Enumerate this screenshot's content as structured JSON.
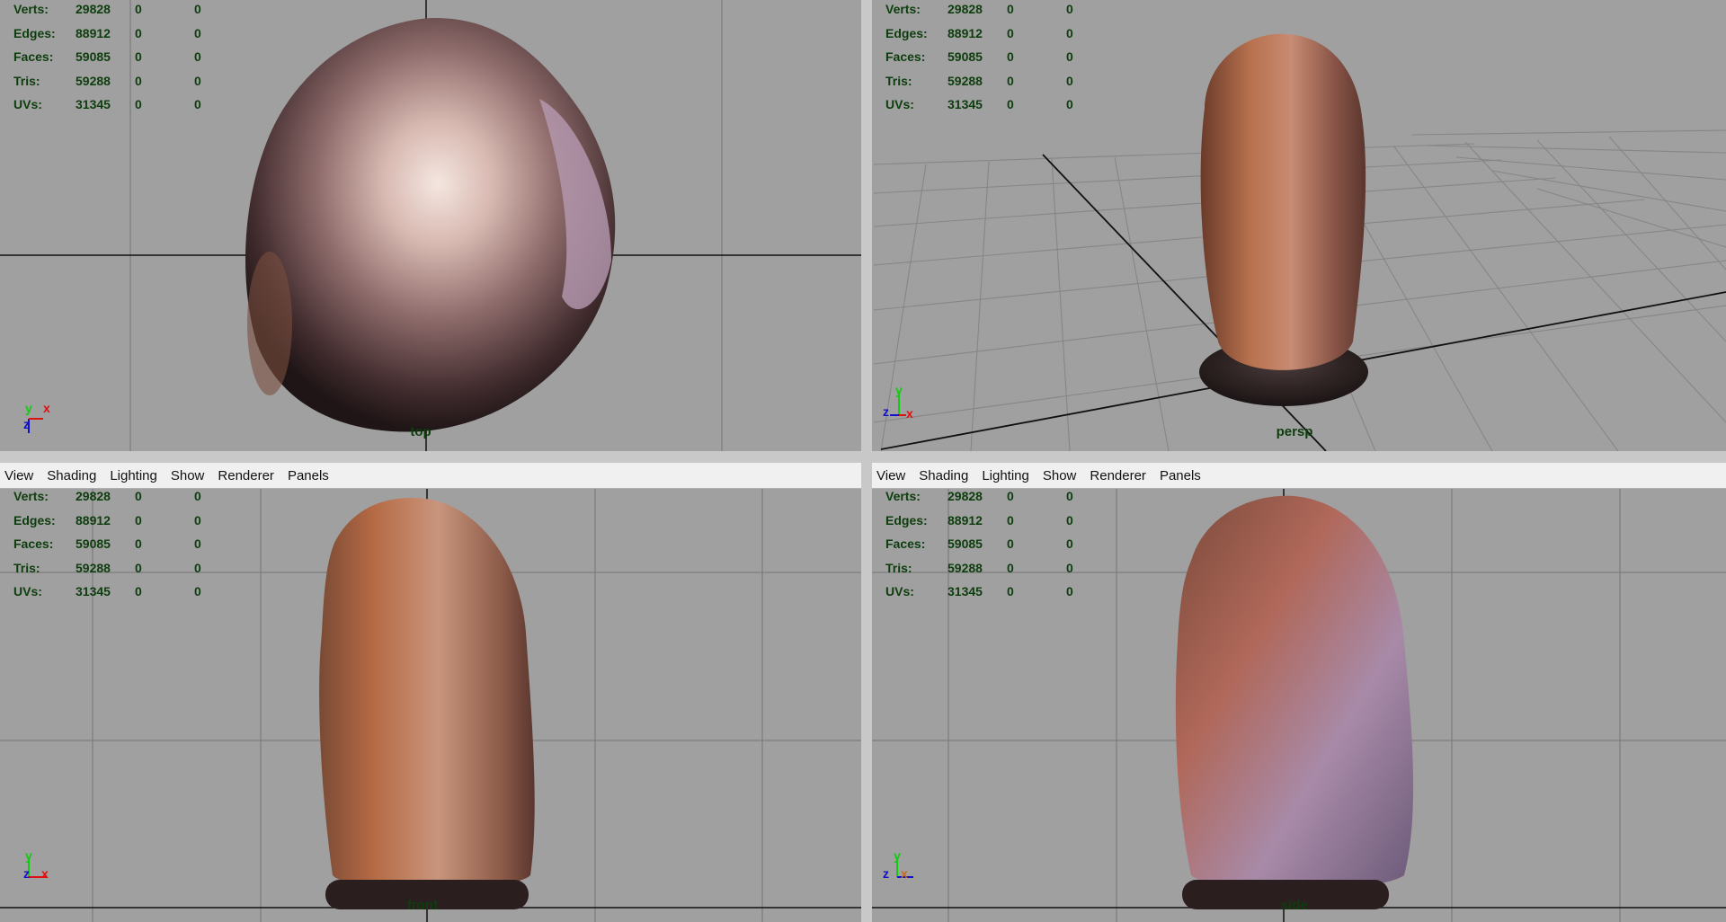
{
  "menu": [
    "View",
    "Shading",
    "Lighting",
    "Show",
    "Renderer",
    "Panels"
  ],
  "hud": {
    "rows": [
      {
        "label": "Verts:",
        "values": [
          "29828",
          "0",
          "0"
        ]
      },
      {
        "label": "Edges:",
        "values": [
          "88912",
          "0",
          "0"
        ]
      },
      {
        "label": "Faces:",
        "values": [
          "59085",
          "0",
          "0"
        ]
      },
      {
        "label": "Tris:",
        "values": [
          "59288",
          "0",
          "0"
        ]
      },
      {
        "label": "UVs:",
        "values": [
          "31345",
          "0",
          "0"
        ]
      }
    ]
  },
  "panels": {
    "top": {
      "camera": "top",
      "axes": [
        "y",
        "x",
        "z"
      ]
    },
    "persp": {
      "camera": "persp",
      "axes": [
        "y",
        "z",
        "x"
      ]
    },
    "front": {
      "camera": "front",
      "axes": [
        "y",
        "z",
        "x"
      ]
    },
    "side": {
      "camera": "side",
      "axes": [
        "y",
        "z",
        "x"
      ]
    }
  },
  "colors": {
    "viewport_bg": "#a0a0a0",
    "grid": "#7c7c7c",
    "hud_text": "#0d3d0d",
    "axis_x": "#dd1111",
    "axis_y": "#11cc11",
    "axis_z": "#1111cc"
  }
}
